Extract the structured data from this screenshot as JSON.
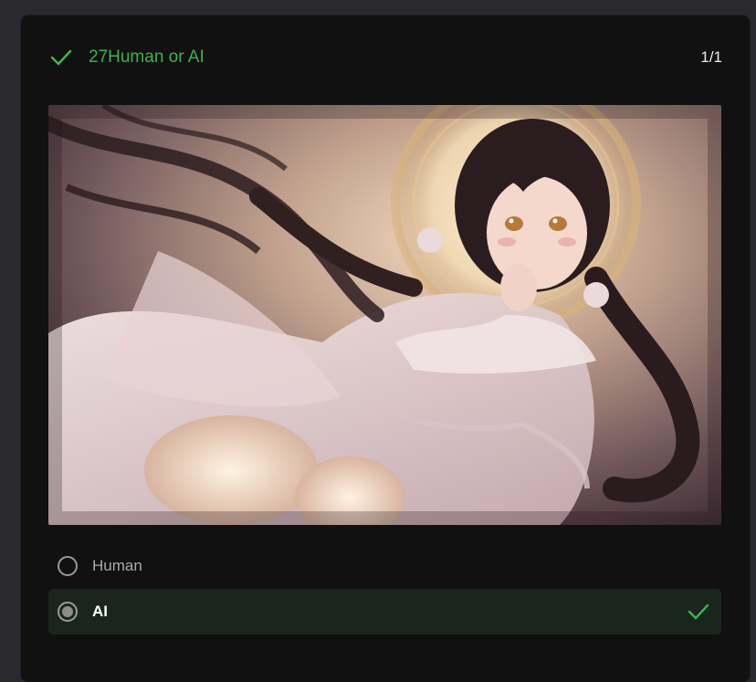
{
  "question": {
    "title": "27Human or AI",
    "counter": "1/1",
    "status_icon": "check-icon",
    "accent_color": "#3fb14e"
  },
  "options": [
    {
      "label": "Human",
      "selected": false
    },
    {
      "label": "AI",
      "selected": true,
      "correct": true
    }
  ]
}
